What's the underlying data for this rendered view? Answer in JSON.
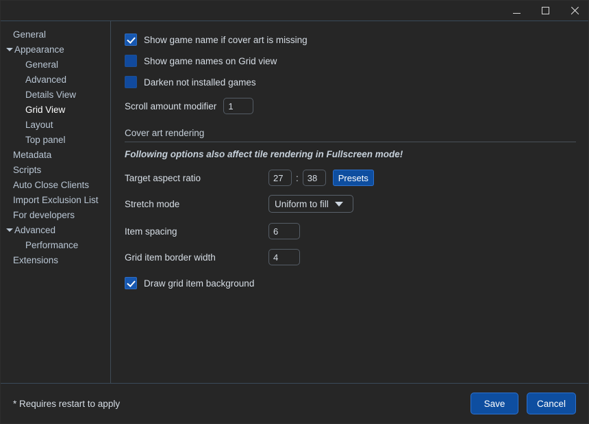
{
  "window": {
    "titlebar": {
      "minimize_label": "minimize",
      "maximize_label": "maximize",
      "close_label": "close"
    }
  },
  "sidebar": {
    "items": [
      {
        "label": "General",
        "level": 0,
        "arrow": false,
        "selected": false
      },
      {
        "label": "Appearance",
        "level": 0,
        "arrow": true,
        "selected": false
      },
      {
        "label": "General",
        "level": 1,
        "arrow": false,
        "selected": false
      },
      {
        "label": "Advanced",
        "level": 1,
        "arrow": false,
        "selected": false
      },
      {
        "label": "Details View",
        "level": 1,
        "arrow": false,
        "selected": false
      },
      {
        "label": "Grid View",
        "level": 1,
        "arrow": false,
        "selected": true
      },
      {
        "label": "Layout",
        "level": 1,
        "arrow": false,
        "selected": false
      },
      {
        "label": "Top panel",
        "level": 1,
        "arrow": false,
        "selected": false
      },
      {
        "label": "Metadata",
        "level": 0,
        "arrow": false,
        "selected": false
      },
      {
        "label": "Scripts",
        "level": 0,
        "arrow": false,
        "selected": false
      },
      {
        "label": "Auto Close Clients",
        "level": 0,
        "arrow": false,
        "selected": false
      },
      {
        "label": "Import Exclusion List",
        "level": 0,
        "arrow": false,
        "selected": false
      },
      {
        "label": "For developers",
        "level": 0,
        "arrow": false,
        "selected": false
      },
      {
        "label": "Advanced",
        "level": 0,
        "arrow": true,
        "selected": false
      },
      {
        "label": "Performance",
        "level": 1,
        "arrow": false,
        "selected": false
      },
      {
        "label": "Extensions",
        "level": 0,
        "arrow": false,
        "selected": false
      }
    ]
  },
  "content": {
    "checkboxes": [
      {
        "label": "Show game name if cover art is missing",
        "checked": true
      },
      {
        "label": "Show game names on Grid view",
        "checked": false
      },
      {
        "label": "Darken not installed games",
        "checked": false
      }
    ],
    "scroll_amount": {
      "label": "Scroll amount modifier",
      "value": "1"
    },
    "section": {
      "title": "Cover art rendering",
      "note": "Following options also affect tile rendering in Fullscreen mode!"
    },
    "aspect_ratio": {
      "label": "Target aspect ratio",
      "width_value": "27",
      "separator": ":",
      "height_value": "38",
      "presets_label": "Presets"
    },
    "stretch_mode": {
      "label": "Stretch mode",
      "selected": "Uniform to fill"
    },
    "item_spacing": {
      "label": "Item spacing",
      "value": "6"
    },
    "border_width": {
      "label": "Grid item border width",
      "value": "4"
    },
    "draw_background": {
      "label": "Draw grid item background",
      "checked": true
    }
  },
  "footer": {
    "note": "* Requires restart to apply",
    "save_label": "Save",
    "cancel_label": "Cancel"
  },
  "colors": {
    "background": "#262626",
    "accent_blue": "#0e4ea0",
    "checkbox_blue": "#114a9e",
    "text": "#d6dde5",
    "separator": "#3f4b57"
  }
}
